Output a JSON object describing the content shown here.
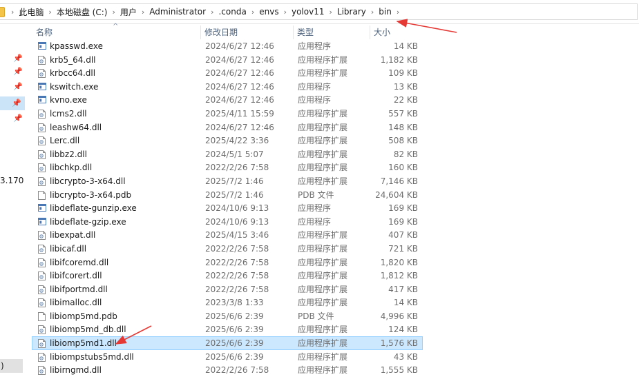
{
  "address": {
    "crumbs": [
      "此电脑",
      "本地磁盘 (C:)",
      "用户",
      "Administrator",
      ".conda",
      "envs",
      "yolov11",
      "Library",
      "bin"
    ],
    "separator": "›"
  },
  "nav": {
    "pin_glyph": "📌",
    "fragments": [
      "3.170",
      ")"
    ]
  },
  "columns": {
    "name": "名称",
    "date": "修改日期",
    "type": "类型",
    "size": "大小",
    "sort_arrow": "^"
  },
  "files": [
    {
      "name": "kpasswd.exe",
      "date": "2024/6/27 12:46",
      "type": "应用程序",
      "size": "14 KB",
      "icon": "exe-icon"
    },
    {
      "name": "krb5_64.dll",
      "date": "2024/6/27 12:46",
      "type": "应用程序扩展",
      "size": "1,182 KB",
      "icon": "dll-icon"
    },
    {
      "name": "krbcc64.dll",
      "date": "2024/6/27 12:46",
      "type": "应用程序扩展",
      "size": "109 KB",
      "icon": "dll-icon"
    },
    {
      "name": "kswitch.exe",
      "date": "2024/6/27 12:46",
      "type": "应用程序",
      "size": "13 KB",
      "icon": "exe-icon"
    },
    {
      "name": "kvno.exe",
      "date": "2024/6/27 12:46",
      "type": "应用程序",
      "size": "22 KB",
      "icon": "exe-icon"
    },
    {
      "name": "lcms2.dll",
      "date": "2025/4/11 15:59",
      "type": "应用程序扩展",
      "size": "557 KB",
      "icon": "dll-icon"
    },
    {
      "name": "leashw64.dll",
      "date": "2024/6/27 12:46",
      "type": "应用程序扩展",
      "size": "148 KB",
      "icon": "dll-icon"
    },
    {
      "name": "Lerc.dll",
      "date": "2025/4/22 3:36",
      "type": "应用程序扩展",
      "size": "508 KB",
      "icon": "dll-icon"
    },
    {
      "name": "libbz2.dll",
      "date": "2024/5/1 5:07",
      "type": "应用程序扩展",
      "size": "82 KB",
      "icon": "dll-icon"
    },
    {
      "name": "libchkp.dll",
      "date": "2022/2/26 7:58",
      "type": "应用程序扩展",
      "size": "160 KB",
      "icon": "dll-icon"
    },
    {
      "name": "libcrypto-3-x64.dll",
      "date": "2025/7/2 1:46",
      "type": "应用程序扩展",
      "size": "7,146 KB",
      "icon": "dll-icon"
    },
    {
      "name": "libcrypto-3-x64.pdb",
      "date": "2025/7/2 1:46",
      "type": "PDB 文件",
      "size": "24,604 KB",
      "icon": "file-icon"
    },
    {
      "name": "libdeflate-gunzip.exe",
      "date": "2024/10/6 9:13",
      "type": "应用程序",
      "size": "169 KB",
      "icon": "exe-icon"
    },
    {
      "name": "libdeflate-gzip.exe",
      "date": "2024/10/6 9:13",
      "type": "应用程序",
      "size": "169 KB",
      "icon": "exe-icon"
    },
    {
      "name": "libexpat.dll",
      "date": "2025/4/15 3:46",
      "type": "应用程序扩展",
      "size": "407 KB",
      "icon": "dll-icon"
    },
    {
      "name": "libicaf.dll",
      "date": "2022/2/26 7:58",
      "type": "应用程序扩展",
      "size": "721 KB",
      "icon": "dll-icon"
    },
    {
      "name": "libifcoremd.dll",
      "date": "2022/2/26 7:58",
      "type": "应用程序扩展",
      "size": "1,820 KB",
      "icon": "dll-icon"
    },
    {
      "name": "libifcorert.dll",
      "date": "2022/2/26 7:58",
      "type": "应用程序扩展",
      "size": "1,812 KB",
      "icon": "dll-icon"
    },
    {
      "name": "libifportmd.dll",
      "date": "2022/2/26 7:58",
      "type": "应用程序扩展",
      "size": "417 KB",
      "icon": "dll-icon"
    },
    {
      "name": "libimalloc.dll",
      "date": "2023/3/8 1:33",
      "type": "应用程序扩展",
      "size": "14 KB",
      "icon": "dll-icon"
    },
    {
      "name": "libiomp5md.pdb",
      "date": "2025/6/6 2:39",
      "type": "PDB 文件",
      "size": "4,996 KB",
      "icon": "file-icon"
    },
    {
      "name": "libiomp5md_db.dll",
      "date": "2025/6/6 2:39",
      "type": "应用程序扩展",
      "size": "124 KB",
      "icon": "dll-icon"
    },
    {
      "name": "libiomp5md1.dll",
      "date": "2025/6/6 2:39",
      "type": "应用程序扩展",
      "size": "1,576 KB",
      "icon": "dll-icon",
      "selected": true
    },
    {
      "name": "libiompstubs5md.dll",
      "date": "2025/6/6 2:39",
      "type": "应用程序扩展",
      "size": "43 KB",
      "icon": "dll-icon"
    },
    {
      "name": "libirngmd.dll",
      "date": "2022/2/26 7:58",
      "type": "应用程序扩展",
      "size": "1,555 KB",
      "icon": "dll-icon"
    }
  ],
  "colors": {
    "selection_bg": "#cce8ff",
    "selection_border": "#99d1ff",
    "header_text": "#4c607a",
    "annotation_arrow": "#e53935"
  }
}
